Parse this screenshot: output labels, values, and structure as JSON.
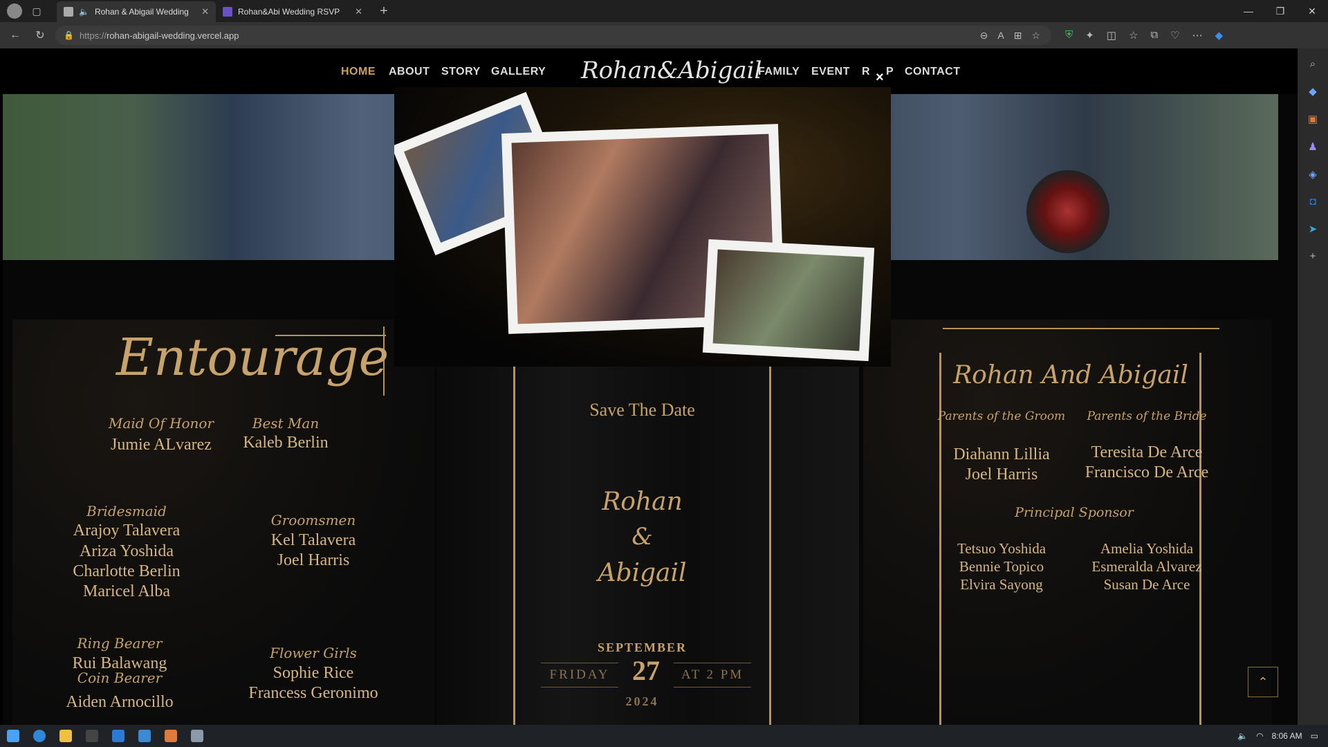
{
  "browser": {
    "tabs": [
      {
        "title": "Rohan & Abigail Wedding",
        "active": true
      },
      {
        "title": "Rohan&Abi Wedding RSVP",
        "active": false
      }
    ],
    "url_protocol": "https://",
    "url_host": "rohan-abigail-wedding.vercel.app"
  },
  "nav": {
    "items": [
      "HOME",
      "ABOUT",
      "STORY",
      "GALLERY",
      "FAMILY",
      "EVENT",
      "R",
      "P",
      "CONTACT"
    ],
    "brand": "Rohan&Abigail"
  },
  "modal": {
    "close": "×"
  },
  "entourage": {
    "title": "Entourage",
    "maid_of_honor_label": "Maid Of Honor",
    "maid_of_honor": "Jumie ALvarez",
    "best_man_label": "Best Man",
    "best_man": "Kaleb Berlin",
    "bridesmaid_label": "Bridesmaid",
    "bridesmaids": [
      "Arajoy Talavera",
      "Ariza Yoshida",
      "Charlotte Berlin",
      "Maricel Alba"
    ],
    "groomsmen_label": "Groomsmen",
    "groomsmen": [
      "Kel Talavera",
      "Joel Harris"
    ],
    "ring_bearer_label": "Ring Bearer",
    "ring_bearer": "Rui Balawang",
    "coin_bearer_label": "Coin Bearer",
    "coin_bearer": "Aiden Arnocillo",
    "flower_girls_label": "Flower Girls",
    "flower_girls": [
      "Sophie Rice",
      "Francess Geronimo"
    ]
  },
  "save_the_date": {
    "heading": "Save The Date",
    "name1": "Rohan",
    "amp": "&",
    "name2": "Abigail",
    "month": "SEPTEMBER",
    "weekday": "FRIDAY",
    "day": "27",
    "time": "AT 2 PM",
    "year": "2024"
  },
  "family": {
    "title": "Rohan And Abigail",
    "groom_parents_label": "Parents of the Groom",
    "groom_parents": [
      "Diahann Lillia",
      "Joel Harris"
    ],
    "bride_parents_label": "Parents of the Bride",
    "bride_parents": [
      "Teresita De Arce",
      "Francisco De Arce"
    ],
    "principal_label": "Principal Sponsor",
    "principal_left": [
      "Tetsuo Yoshida",
      "Bennie Topico",
      "Elvira Sayong"
    ],
    "principal_right": [
      "Amelia Yoshida",
      "Esmeralda Alvarez",
      "Susan De Arce"
    ]
  },
  "taskbar": {
    "time": "8:06 AM"
  }
}
